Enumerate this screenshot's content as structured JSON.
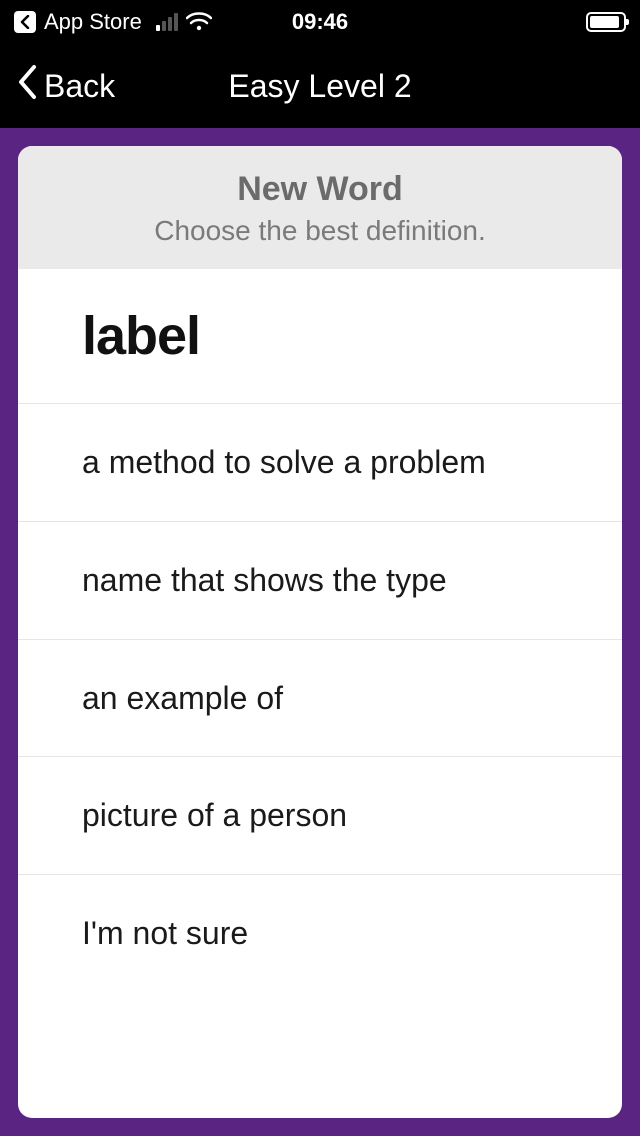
{
  "statusBar": {
    "appStoreLabel": "App Store",
    "time": "09:46"
  },
  "nav": {
    "backLabel": "Back",
    "title": "Easy Level 2"
  },
  "card": {
    "headerTitle": "New Word",
    "headerSubtitle": "Choose the best definition.",
    "word": "label",
    "options": [
      "a method to solve a problem",
      "name that shows the type",
      "an example of",
      "picture of a person",
      "I'm not sure"
    ]
  }
}
